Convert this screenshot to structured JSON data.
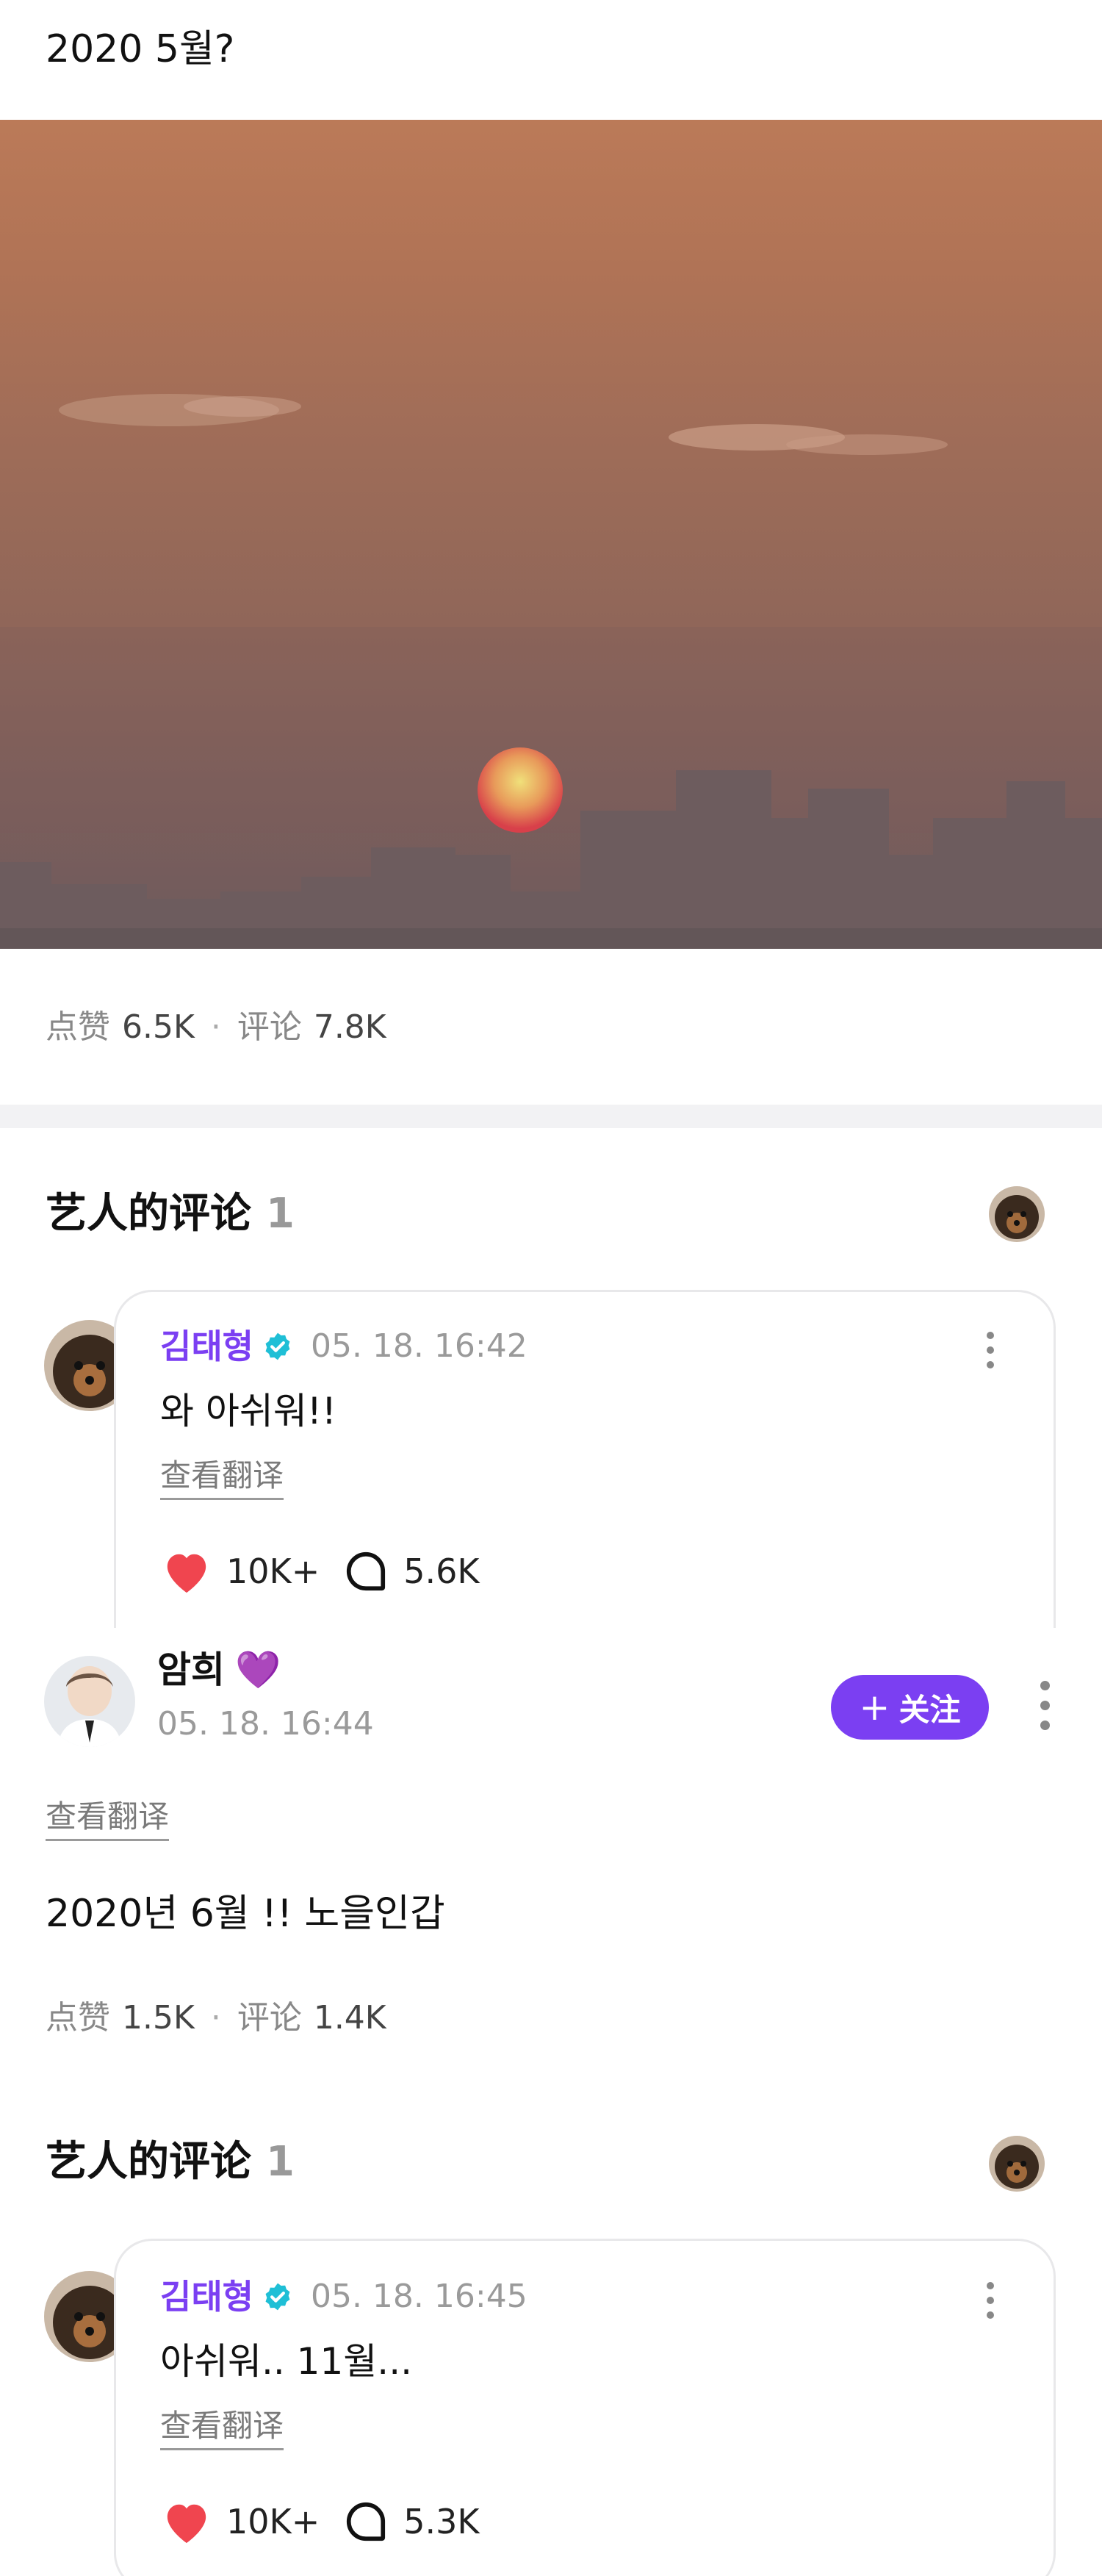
{
  "post1": {
    "text": "2020 5월?",
    "stats": {
      "like_label": "点赞",
      "like_count": "6.5K",
      "comment_label": "评论",
      "comment_count": "7.8K"
    }
  },
  "artist_section_1": {
    "title": "艺人的评论",
    "count": "1",
    "comment": {
      "author": "김태형",
      "timestamp": "05. 18. 16:42",
      "text": "와 아쉬워!!",
      "translate_label": "查看翻译",
      "likes": "10K+",
      "replies": "5.6K"
    }
  },
  "post2": {
    "author": "암희",
    "heart_emoji": "💜",
    "timestamp": "05. 18. 16:44",
    "follow_label": "关注",
    "translate_label": "查看翻译",
    "text": "2020년 6월 !! 노을인갑",
    "stats": {
      "like_label": "点赞",
      "like_count": "1.5K",
      "comment_label": "评论",
      "comment_count": "1.4K"
    }
  },
  "artist_section_2": {
    "title": "艺人的评论",
    "count": "1",
    "comment": {
      "author": "김태형",
      "timestamp": "05. 18. 16:45",
      "text": "아쉬워.. 11월...",
      "translate_label": "查看翻译",
      "likes": "10K+",
      "replies": "5.3K"
    }
  },
  "colors": {
    "accent": "#7b3ff2",
    "verified": "#1fbfd6",
    "like_heart": "#f0454f"
  },
  "icons": {
    "verified": "verified-badge-icon",
    "like": "heart-icon",
    "comment": "comment-bubble-icon",
    "more": "more-vertical-icon",
    "follow": "plus-icon"
  }
}
